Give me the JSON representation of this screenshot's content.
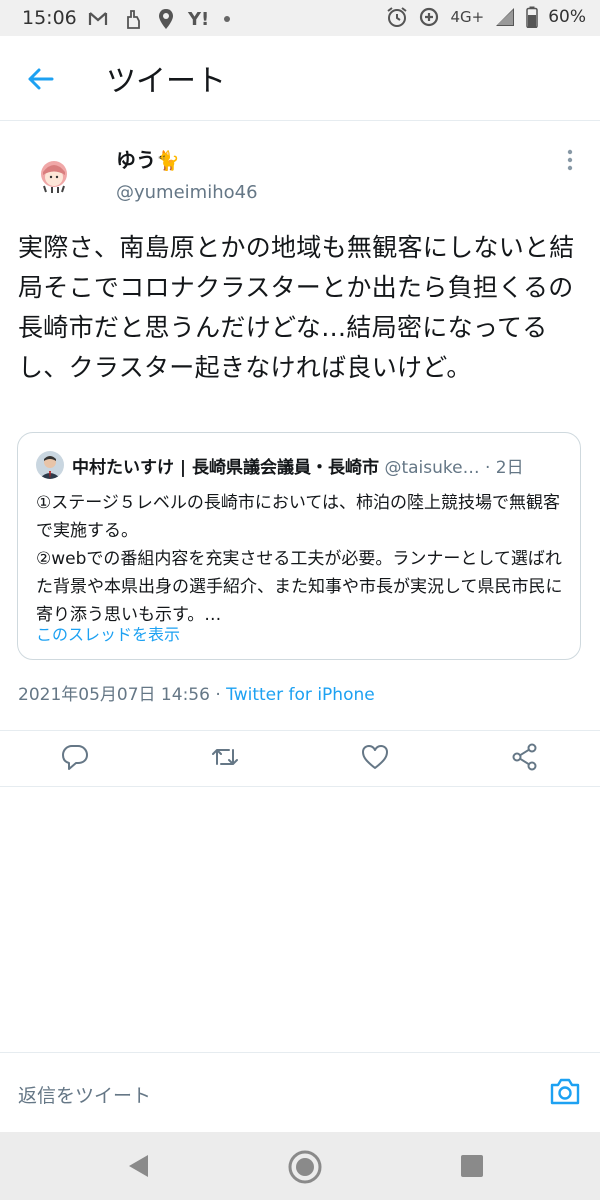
{
  "status_bar": {
    "time": "15:06",
    "left_icons": [
      "gmail-icon",
      "hand-icon",
      "location-icon",
      "yahoo-icon",
      "dot-icon"
    ],
    "yahoo_text": "Y!",
    "network": "4G+",
    "battery": "60%"
  },
  "header": {
    "title": "ツイート"
  },
  "tweet": {
    "display_name": "ゆう",
    "name_emoji": "🐈",
    "username": "@yumeimiho46",
    "text": "実際さ、南島原とかの地域も無観客にしないと結局そこでコロナクラスターとか出たら負担くるの長崎市だと思うんだけどな…結局密になってるし、クラスター起きなければ良いけど。",
    "timestamp": "2021年05月07日 14:56",
    "separator": " · ",
    "source": "Twitter for iPhone"
  },
  "quoted_tweet": {
    "name": "中村たいすけ | 長崎県議会議員・長崎市",
    "handle": "@taisuke…",
    "age": "· 2日",
    "text_line1": "①ステージ５レベルの長崎市においては、柿泊の陸上競技場で無観客で実施する。",
    "text_line2": "②webでの番組内容を充実させる工夫が必要。ランナーとして選ばれた背景や本県出身の選手紹介、また知事や市長が実況して県民市民に寄り添う思いも示す。…",
    "show_thread": "このスレッドを表示"
  },
  "reply_bar": {
    "placeholder": "返信をツイート"
  },
  "colors": {
    "accent": "#1da1f2",
    "secondary_text": "#657786",
    "border": "#e6ecf0"
  }
}
